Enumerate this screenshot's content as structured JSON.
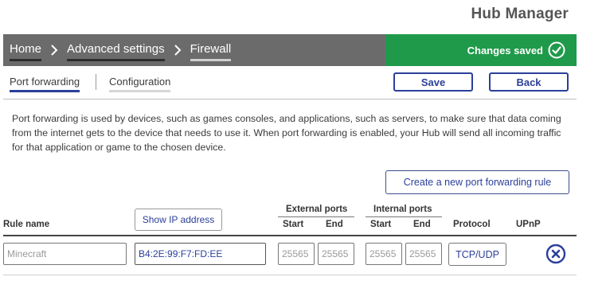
{
  "app": {
    "title": "Hub Manager"
  },
  "breadcrumb": {
    "items": [
      {
        "label": "Home"
      },
      {
        "label": "Advanced settings"
      },
      {
        "label": "Firewall"
      }
    ]
  },
  "status": {
    "saved_label": "Changes saved",
    "icon": "check-circle-icon",
    "color": "#1f9a4a"
  },
  "tabs": [
    {
      "label": "Port forwarding",
      "active": true
    },
    {
      "label": "Configuration",
      "active": false
    }
  ],
  "actions": {
    "save_label": "Save",
    "back_label": "Back"
  },
  "description": "Port forwarding is used by devices, such as games consoles, and applications, such as servers, to make sure that data coming from the internet gets to the device that needs to use it. When port forwarding is enabled, your Hub will send all incoming traffic for that application or game to the chosen device.",
  "create_rule_label": "Create a new port forwarding rule",
  "table": {
    "headers": {
      "rule_name": "Rule name",
      "show_ip": "Show IP address",
      "external_ports": "External ports",
      "internal_ports": "Internal ports",
      "start": "Start",
      "end": "End",
      "protocol": "Protocol",
      "upnp": "UPnP"
    },
    "row": {
      "rule_name_placeholder": "Minecraft",
      "mac_value": "B4:2E:99:F7:FD:EE",
      "external_start_placeholder": "25565",
      "external_end_placeholder": "25565",
      "internal_start_placeholder": "25565",
      "internal_end_placeholder": "25565",
      "protocol": "TCP/UDP",
      "remove_icon": "remove-circle-icon"
    }
  },
  "colors": {
    "accent": "#2b3f9a",
    "nav_bg": "#6b6b6b",
    "success": "#1f9a4a"
  }
}
